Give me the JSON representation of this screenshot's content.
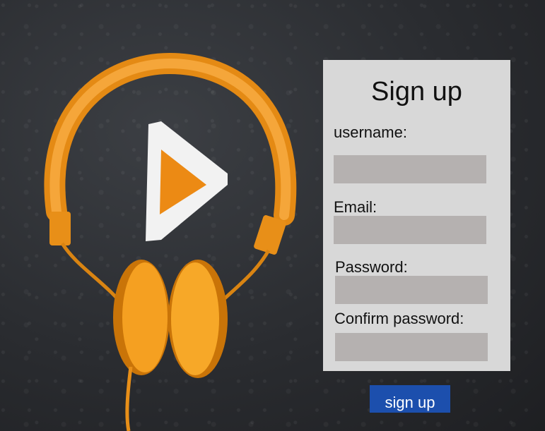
{
  "form": {
    "title": "Sign up",
    "username_label": "username:",
    "email_label": "Email:",
    "password_label": "Password:",
    "confirm_label": "Confirm password:",
    "username_value": "",
    "email_value": "",
    "password_value": "",
    "confirm_value": "",
    "submit_label": "sign up"
  },
  "colors": {
    "accent": "#1c4fad",
    "headphones": "#f39a1e",
    "panel": "#d8d8d8",
    "field": "#b5b1b0"
  },
  "icons": [
    "headphones-illustration",
    "play-icon"
  ]
}
